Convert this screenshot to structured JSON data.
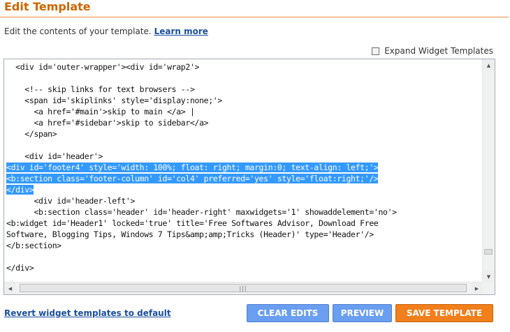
{
  "header": {
    "title": "Edit Template",
    "description": "Edit the contents of your template.",
    "learn_more": "Learn more"
  },
  "options": {
    "expand_widget_label": "Expand Widget Templates",
    "expand_checked": false
  },
  "editor": {
    "lines": [
      {
        "text": "  <div id='outer-wrapper'><div id='wrap2'>",
        "selected": false
      },
      {
        "text": "",
        "selected": false
      },
      {
        "text": "    <!-- skip links for text browsers -->",
        "selected": false
      },
      {
        "text": "    <span id='skiplinks' style='display:none;'>",
        "selected": false
      },
      {
        "text": "      <a href='#main'>skip to main </a> |",
        "selected": false
      },
      {
        "text": "      <a href='#sidebar'>skip to sidebar</a>",
        "selected": false
      },
      {
        "text": "    </span>",
        "selected": false
      },
      {
        "text": "",
        "selected": false
      },
      {
        "text": "    <div id='header'>",
        "selected": false
      },
      {
        "text": "<div id='footer4' style='width: 100%; float: right; margin:0; text-align: left;'>",
        "selected": true
      },
      {
        "text": "<b:section class='footer-column' id='col4' preferred='yes' style='float:right;'/>",
        "selected": true
      },
      {
        "text": "</div>",
        "selected": true
      },
      {
        "text": "      <div id='header-left'>",
        "selected": false
      },
      {
        "text": "      <b:section class='header' id='header-right' maxwidgets='1' showaddelement='no'>",
        "selected": false
      },
      {
        "text": "<b:widget id='Header1' locked='true' title='Free Softwares Advisor, Download Free",
        "selected": false
      },
      {
        "text": "Software, Blogging Tips, Windows 7 Tips&amp;amp;Tricks (Header)' type='Header'/>",
        "selected": false
      },
      {
        "text": "</b:section>",
        "selected": false
      },
      {
        "text": "",
        "selected": false
      },
      {
        "text": "</div>",
        "selected": false
      }
    ]
  },
  "footer": {
    "revert_link": "Revert widget templates to default",
    "clear_edits": "CLEAR EDITS",
    "preview": "PREVIEW",
    "save_template": "SAVE TEMPLATE"
  },
  "colors": {
    "title": "#cc6600",
    "link": "#1a4e9c",
    "selection": "#3399ff",
    "button_blue": "#6a9ef0",
    "button_orange": "#f07f1c"
  }
}
